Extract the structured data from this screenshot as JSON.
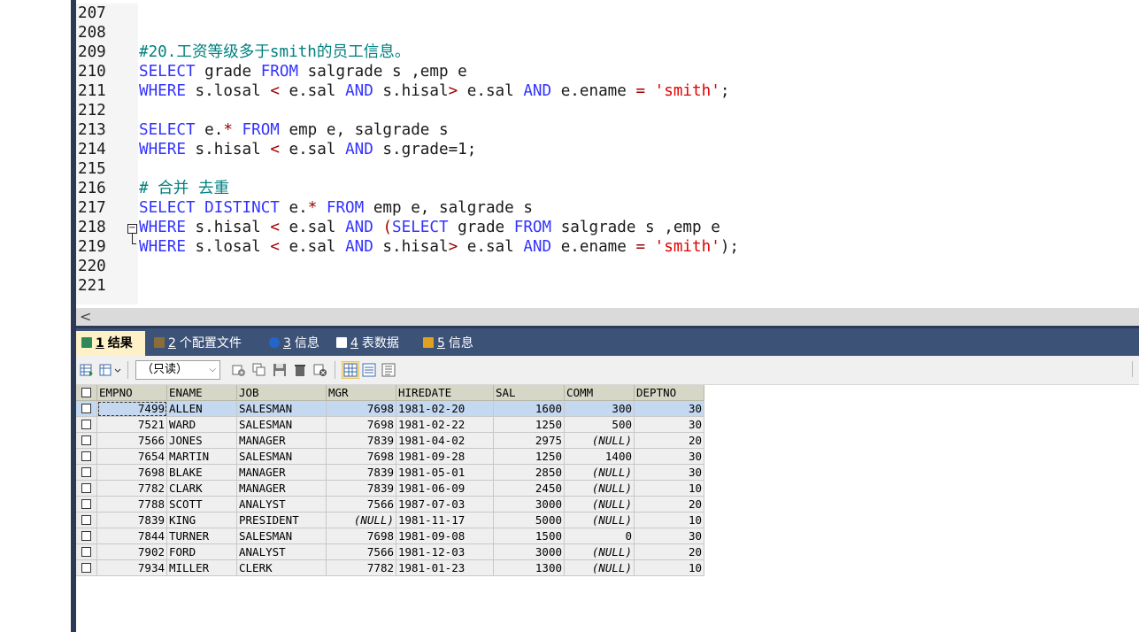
{
  "editor": {
    "lines": [
      {
        "no": "207",
        "tokens": []
      },
      {
        "no": "208",
        "tokens": []
      },
      {
        "no": "209",
        "tokens": [
          {
            "t": "#20.工资等级多于smith的员工信息。",
            "c": "cm"
          }
        ]
      },
      {
        "no": "210",
        "tokens": [
          {
            "t": "SELECT",
            "c": "kw"
          },
          {
            "t": " grade ",
            "c": ""
          },
          {
            "t": "FROM",
            "c": "kw"
          },
          {
            "t": " salgrade s ,emp e",
            "c": ""
          }
        ]
      },
      {
        "no": "211",
        "tokens": [
          {
            "t": "WHERE",
            "c": "kw"
          },
          {
            "t": " s.losal ",
            "c": ""
          },
          {
            "t": "<",
            "c": "op"
          },
          {
            "t": " e.sal ",
            "c": ""
          },
          {
            "t": "AND",
            "c": "kw"
          },
          {
            "t": " s.hisal",
            "c": ""
          },
          {
            "t": ">",
            "c": "op"
          },
          {
            "t": " e.sal ",
            "c": ""
          },
          {
            "t": "AND",
            "c": "kw"
          },
          {
            "t": " e.ename ",
            "c": ""
          },
          {
            "t": "=",
            "c": "op"
          },
          {
            "t": " ",
            "c": ""
          },
          {
            "t": "'smith'",
            "c": "str"
          },
          {
            "t": ";",
            "c": ""
          }
        ]
      },
      {
        "no": "212",
        "tokens": []
      },
      {
        "no": "213",
        "tokens": [
          {
            "t": "SELECT",
            "c": "kw"
          },
          {
            "t": " e.",
            "c": ""
          },
          {
            "t": "*",
            "c": "op"
          },
          {
            "t": " ",
            "c": ""
          },
          {
            "t": "FROM",
            "c": "kw"
          },
          {
            "t": " emp e, salgrade s",
            "c": ""
          }
        ]
      },
      {
        "no": "214",
        "tokens": [
          {
            "t": "WHERE",
            "c": "kw"
          },
          {
            "t": " s.hisal ",
            "c": ""
          },
          {
            "t": "<",
            "c": "op"
          },
          {
            "t": " e.sal ",
            "c": ""
          },
          {
            "t": "AND",
            "c": "kw"
          },
          {
            "t": " s.grade=1;",
            "c": ""
          }
        ]
      },
      {
        "no": "215",
        "tokens": []
      },
      {
        "no": "216",
        "tokens": [
          {
            "t": "# 合并 去重",
            "c": "cm"
          }
        ]
      },
      {
        "no": "217",
        "tokens": [
          {
            "t": "SELECT",
            "c": "kw"
          },
          {
            "t": " ",
            "c": ""
          },
          {
            "t": "DISTINCT",
            "c": "kw"
          },
          {
            "t": " e.",
            "c": ""
          },
          {
            "t": "*",
            "c": "op"
          },
          {
            "t": " ",
            "c": ""
          },
          {
            "t": "FROM",
            "c": "kw"
          },
          {
            "t": " emp e, salgrade s",
            "c": ""
          }
        ]
      },
      {
        "no": "218",
        "tokens": [
          {
            "t": "WHERE",
            "c": "kw"
          },
          {
            "t": " s.hisal ",
            "c": ""
          },
          {
            "t": "<",
            "c": "op"
          },
          {
            "t": " e.sal ",
            "c": ""
          },
          {
            "t": "AND",
            "c": "kw"
          },
          {
            "t": " ",
            "c": ""
          },
          {
            "t": "(",
            "c": "op"
          },
          {
            "t": "SELECT",
            "c": "kw"
          },
          {
            "t": " grade ",
            "c": ""
          },
          {
            "t": "FROM",
            "c": "kw"
          },
          {
            "t": " salgrade s ,emp e",
            "c": ""
          }
        ]
      },
      {
        "no": "219",
        "tokens": [
          {
            "t": "WHERE",
            "c": "kw"
          },
          {
            "t": " s.losal ",
            "c": ""
          },
          {
            "t": "<",
            "c": "op"
          },
          {
            "t": " e.sal ",
            "c": ""
          },
          {
            "t": "AND",
            "c": "kw"
          },
          {
            "t": " s.hisal",
            "c": ""
          },
          {
            "t": ">",
            "c": "op"
          },
          {
            "t": " e.sal ",
            "c": ""
          },
          {
            "t": "AND",
            "c": "kw"
          },
          {
            "t": " e.ename ",
            "c": ""
          },
          {
            "t": "=",
            "c": "op"
          },
          {
            "t": " ",
            "c": ""
          },
          {
            "t": "'smith'",
            "c": "str"
          },
          {
            "t": ");",
            "c": ""
          }
        ]
      },
      {
        "no": "220",
        "tokens": []
      },
      {
        "no": "221",
        "tokens": []
      }
    ]
  },
  "scrollbar": {
    "left_arrow": "<"
  },
  "tabs": [
    {
      "num": "1",
      "label": "结果",
      "icon": "result-grid-icon",
      "active": true
    },
    {
      "num": "2",
      "label": "个配置文件",
      "icon": "profile-icon",
      "active": false
    },
    {
      "num": "3",
      "label": "信息",
      "icon": "info-icon",
      "active": false
    },
    {
      "num": "4",
      "label": "表数据",
      "icon": "table-data-icon",
      "active": false
    },
    {
      "num": "5",
      "label": "信息",
      "icon": "history-icon",
      "active": false
    }
  ],
  "toolbar": {
    "mode": "（只读）"
  },
  "colors": {
    "keyword": "#3333ff",
    "comment": "#008080",
    "string": "#e00000",
    "tab_bar": "#3d5277",
    "active_tab": "#fff1c7",
    "selected_row": "#c4d8f0",
    "header": "#d7d7c7"
  },
  "grid": {
    "columns": [
      "EMPNO",
      "ENAME",
      "JOB",
      "MGR",
      "HIREDATE",
      "SAL",
      "COMM",
      "DEPTNO"
    ],
    "rows": [
      [
        "7499",
        "ALLEN",
        "SALESMAN",
        "7698",
        "1981-02-20",
        "1600",
        "300",
        "30"
      ],
      [
        "7521",
        "WARD",
        "SALESMAN",
        "7698",
        "1981-02-22",
        "1250",
        "500",
        "30"
      ],
      [
        "7566",
        "JONES",
        "MANAGER",
        "7839",
        "1981-04-02",
        "2975",
        "(NULL)",
        "20"
      ],
      [
        "7654",
        "MARTIN",
        "SALESMAN",
        "7698",
        "1981-09-28",
        "1250",
        "1400",
        "30"
      ],
      [
        "7698",
        "BLAKE",
        "MANAGER",
        "7839",
        "1981-05-01",
        "2850",
        "(NULL)",
        "30"
      ],
      [
        "7782",
        "CLARK",
        "MANAGER",
        "7839",
        "1981-06-09",
        "2450",
        "(NULL)",
        "10"
      ],
      [
        "7788",
        "SCOTT",
        "ANALYST",
        "7566",
        "1987-07-03",
        "3000",
        "(NULL)",
        "20"
      ],
      [
        "7839",
        "KING",
        "PRESIDENT",
        "(NULL)",
        "1981-11-17",
        "5000",
        "(NULL)",
        "10"
      ],
      [
        "7844",
        "TURNER",
        "SALESMAN",
        "7698",
        "1981-09-08",
        "1500",
        "0",
        "30"
      ],
      [
        "7902",
        "FORD",
        "ANALYST",
        "7566",
        "1981-12-03",
        "3000",
        "(NULL)",
        "20"
      ],
      [
        "7934",
        "MILLER",
        "CLERK",
        "7782",
        "1981-01-23",
        "1300",
        "(NULL)",
        "10"
      ]
    ]
  }
}
